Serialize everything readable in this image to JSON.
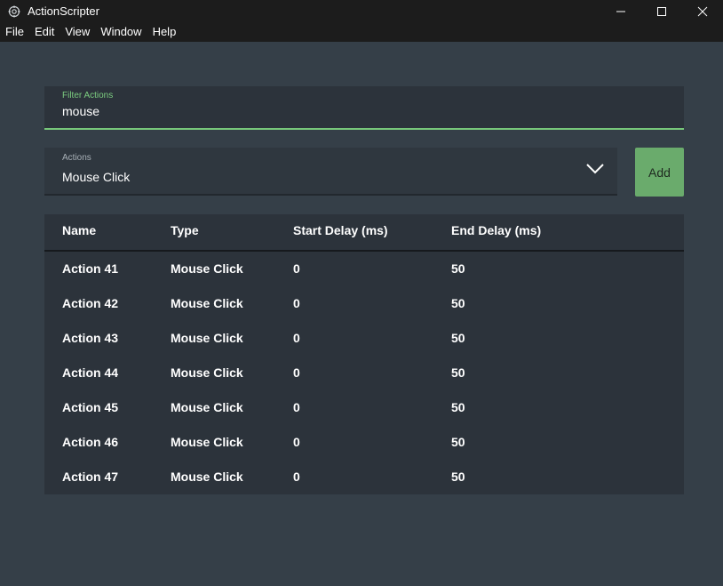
{
  "window": {
    "title": "ActionScripter",
    "controls": [
      "minimize-icon",
      "maximize-icon",
      "close-icon"
    ]
  },
  "menu": [
    "File",
    "Edit",
    "View",
    "Window",
    "Help"
  ],
  "filter": {
    "label": "Filter Actions",
    "value": "mouse",
    "accent": "#77c77a"
  },
  "actions_select": {
    "label": "Actions",
    "value": "Mouse Click"
  },
  "add_button": {
    "label": "Add",
    "color": "#6aab6c"
  },
  "table": {
    "headers": [
      "Name",
      "Type",
      "Start Delay (ms)",
      "End Delay (ms)"
    ],
    "rows": [
      [
        "Action 41",
        "Mouse Click",
        "0",
        "50"
      ],
      [
        "Action 42",
        "Mouse Click",
        "0",
        "50"
      ],
      [
        "Action 43",
        "Mouse Click",
        "0",
        "50"
      ],
      [
        "Action 44",
        "Mouse Click",
        "0",
        "50"
      ],
      [
        "Action 45",
        "Mouse Click",
        "0",
        "50"
      ],
      [
        "Action 46",
        "Mouse Click",
        "0",
        "50"
      ],
      [
        "Action 47",
        "Mouse Click",
        "0",
        "50"
      ]
    ]
  }
}
